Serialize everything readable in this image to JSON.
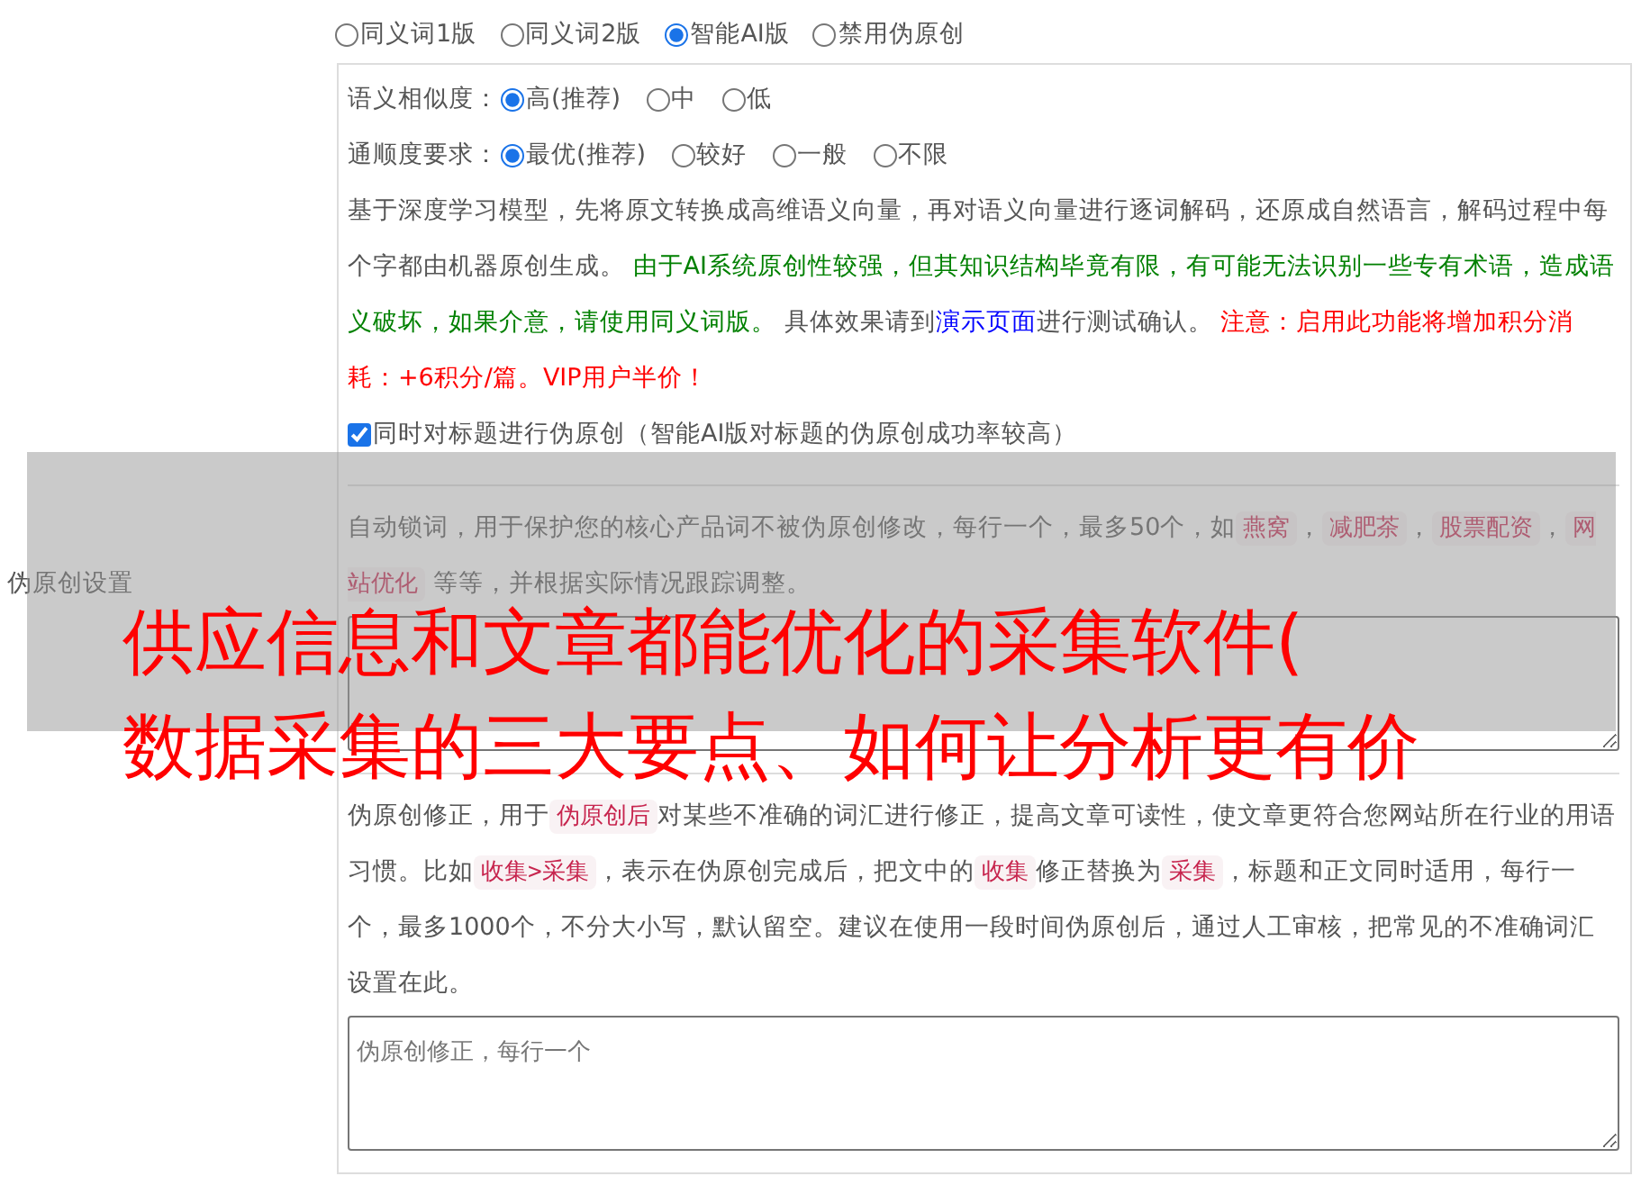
{
  "section_label": "伪原创设置",
  "modes": [
    {
      "label": "同义词1版",
      "selected": false
    },
    {
      "label": "同义词2版",
      "selected": false
    },
    {
      "label": "智能AI版",
      "selected": true
    },
    {
      "label": "禁用伪原创",
      "selected": false
    }
  ],
  "similarity": {
    "label": "语义相似度：",
    "options": [
      {
        "label": "高(推荐)",
        "selected": true
      },
      {
        "label": "中",
        "selected": false
      },
      {
        "label": "低",
        "selected": false
      }
    ]
  },
  "fluency": {
    "label": "通顺度要求：",
    "options": [
      {
        "label": "最优(推荐)",
        "selected": true
      },
      {
        "label": "较好",
        "selected": false
      },
      {
        "label": "一般",
        "selected": false
      },
      {
        "label": "不限",
        "selected": false
      }
    ]
  },
  "ai_description": [
    {
      "kind": "text",
      "color": "#555555",
      "text": "基于深度学习模型，先将原文转换成高维语义向量，再对语义向量进行逐词解码，还原成自然语言，解码过程中每个字都由机器原创生成。 "
    },
    {
      "kind": "text",
      "color": "#008000",
      "text": "由于AI系统原创性较强，但其知识结构毕竟有限，有可能无法识别一些专有术语，造成语义破坏，如果介意，请使用同义词版。"
    },
    {
      "kind": "text",
      "color": "#555555",
      "text": " 具体效果请到"
    },
    {
      "kind": "link",
      "color": "#0000ff",
      "text": "演示页面"
    },
    {
      "kind": "text",
      "color": "#555555",
      "text": "进行测试确认。 "
    },
    {
      "kind": "text",
      "color": "#ff0000",
      "text": "注意：启用此功能将增加积分消耗：+6积分/篇。VIP用户半价！"
    }
  ],
  "title_option": {
    "label": "同时对标题进行伪原创（智能AI版对标题的伪原创成功率较高）",
    "checked": true
  },
  "lock_words": {
    "segments": [
      {
        "kind": "text",
        "text": "自动锁词，用于保护您的核心产品词不被伪原创修改，每行一个，最多50个，如"
      },
      {
        "kind": "tag",
        "text": "燕窝"
      },
      {
        "kind": "text",
        "text": "，"
      },
      {
        "kind": "tag",
        "text": "减肥茶"
      },
      {
        "kind": "text",
        "text": "，"
      },
      {
        "kind": "tag",
        "text": "股票配资"
      },
      {
        "kind": "text",
        "text": "，"
      },
      {
        "kind": "tag",
        "text": "网站优化"
      },
      {
        "kind": "text",
        "text": " 等等，并根据实际情况跟踪调整。"
      }
    ]
  },
  "correction": {
    "segments": [
      {
        "kind": "text",
        "text": "伪原创修正，用于"
      },
      {
        "kind": "tag",
        "text": "伪原创后"
      },
      {
        "kind": "text",
        "text": "对某些不准确的词汇进行修正，提高文章可读性，使文章更符合您网站所在行业的用语习惯。比如"
      },
      {
        "kind": "tag",
        "text": "收集>采集"
      },
      {
        "kind": "text",
        "text": "，表示在伪原创完成后，把文中的"
      },
      {
        "kind": "tag",
        "text": "收集"
      },
      {
        "kind": "text",
        "text": "修正替换为"
      },
      {
        "kind": "tag",
        "text": "采集"
      },
      {
        "kind": "text",
        "text": "，标题和正文同时适用，每行一个，最多1000个，不分大小写，默认留空。建议在使用一段时间伪原创后，通过人工审核，把常见的不准确词汇设置在此。"
      }
    ],
    "placeholder": "伪原创修正，每行一个"
  },
  "overlay": {
    "lines": [
      "供应信息和文章都能优化的采集软件(",
      "数据采集的三大要点、如何让分析更有价"
    ]
  }
}
